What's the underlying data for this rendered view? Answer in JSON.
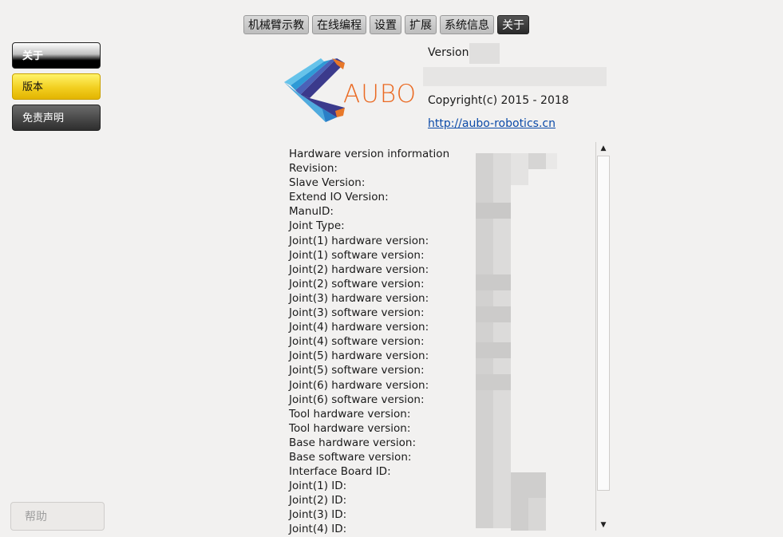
{
  "tabs": [
    "机械臂示教",
    "在线编程",
    "设置",
    "扩展",
    "系统信息",
    "关于"
  ],
  "active_tab": "关于",
  "sidebar": {
    "items": [
      "关于",
      "版本",
      "免责声明"
    ],
    "help_label": "帮助"
  },
  "about": {
    "logo_text": "AUBO",
    "version_label": "Version",
    "copyright": "Copyright(c) 2015 - 2018",
    "link": "http://aubo-robotics.cn"
  },
  "info_rows": [
    "Hardware version information",
    "Revision:",
    "Slave Version:",
    "Extend IO Version:",
    "ManuID:",
    "Joint Type:",
    "Joint(1) hardware version:",
    "Joint(1) software version:",
    "Joint(2) hardware version:",
    "Joint(2) software version:",
    "Joint(3) hardware version:",
    "Joint(3) software version:",
    "Joint(4) hardware version:",
    "Joint(4) software version:",
    "Joint(5) hardware version:",
    "Joint(5) software version:",
    "Joint(6) hardware version:",
    "Joint(6) software version:",
    "Tool hardware version:",
    "Tool hardware version:",
    "Base hardware version:",
    "Base software version:",
    "Interface Board ID:",
    "Joint(1) ID:",
    "Joint(2) ID:",
    "Joint(3) ID:",
    "Joint(4) ID:"
  ],
  "scrollbar": {
    "up_icon": "triangle-up",
    "down_icon": "triangle-down"
  }
}
